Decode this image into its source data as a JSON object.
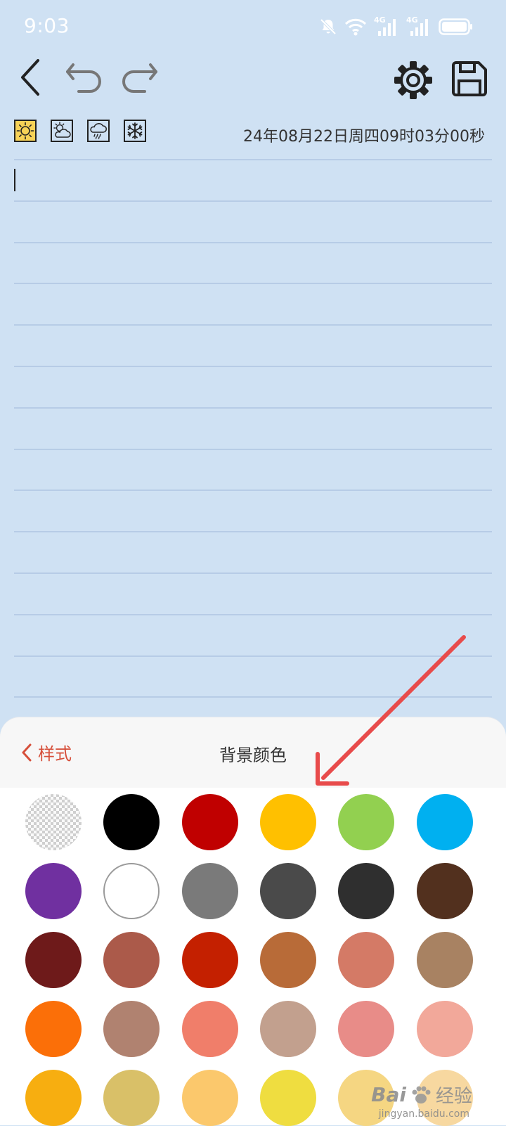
{
  "status_bar": {
    "time": "9:03",
    "network_1": "4G",
    "network_2": "4G"
  },
  "toolbar": {
    "icons": [
      "back-icon",
      "undo-icon",
      "redo-icon",
      "settings-icon",
      "save-icon"
    ]
  },
  "weather": {
    "options": [
      "sunny-icon",
      "partly-cloudy-icon",
      "rain-icon",
      "snow-icon"
    ],
    "selected_index": 0
  },
  "datetime": "24年08月22日周四09时03分00秒",
  "sheet": {
    "back_label": "样式",
    "title": "背景颜色"
  },
  "colors": {
    "swatches": [
      "transparent",
      "#000000",
      "#c00000",
      "#ffc000",
      "#92d050",
      "#00b0f0",
      "#7030a0",
      "#ffffff",
      "#7a7a7a",
      "#4a4a4a",
      "#2f2f2f",
      "#52301e",
      "#6e1a1a",
      "#ab5a4a",
      "#c42000",
      "#b86b38",
      "#d47a66",
      "#a88262",
      "#fb6f08",
      "#b08270",
      "#f07e6a",
      "#c2a08e",
      "#e88c88",
      "#f2a89a",
      "#f7ae10",
      "#d9c068",
      "#fbc86c",
      "#efdd40",
      "#f5d682",
      "#f7d8a0"
    ],
    "accent": "#d64f3a",
    "arrow_color": "#e84b4b"
  },
  "watermark": {
    "text": "Bai",
    "text2": "经验",
    "sub": "jingyan.baidu.com"
  }
}
